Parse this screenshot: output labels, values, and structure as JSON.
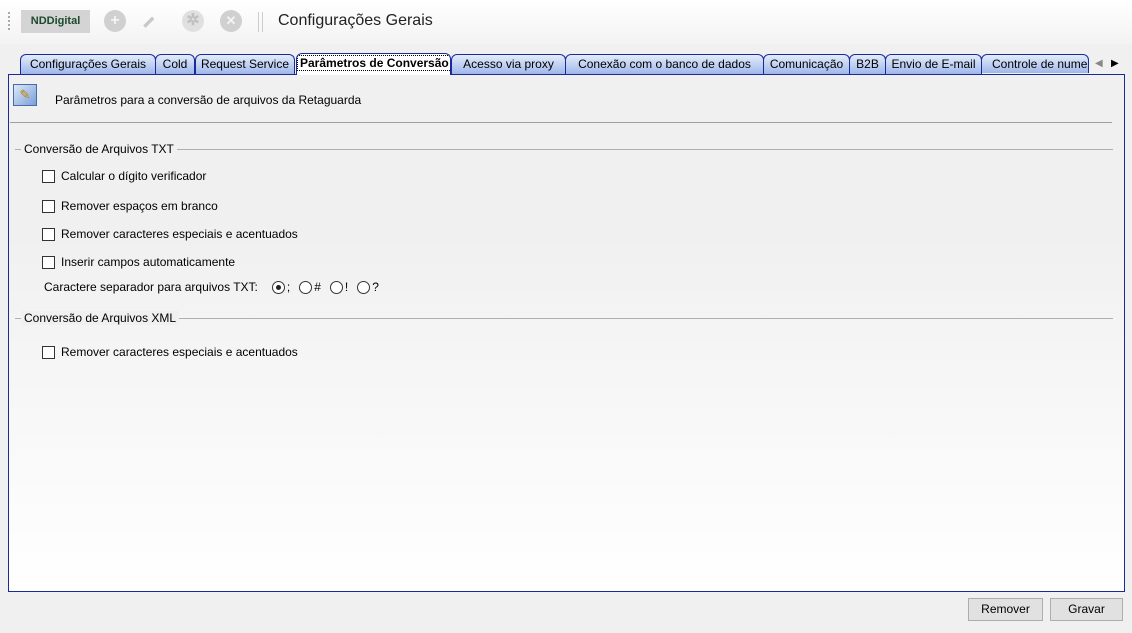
{
  "toolbar": {
    "logo": "NDDigital",
    "title": "Configurações Gerais",
    "icons": [
      "add-icon",
      "edit-icon",
      "settings-icon",
      "delete-icon"
    ]
  },
  "tabs": [
    {
      "label": "Configurações Gerais"
    },
    {
      "label": "Cold"
    },
    {
      "label": "Request Service"
    },
    {
      "label": "Parâmetros de Conversão",
      "active": true
    },
    {
      "label": "Acesso via proxy"
    },
    {
      "label": "Conexão com o banco de dados"
    },
    {
      "label": "Comunicação"
    },
    {
      "label": "B2B"
    },
    {
      "label": "Envio de E-mail"
    },
    {
      "label": "Controle de numeração"
    }
  ],
  "header": {
    "description": "Parâmetros para a conversão de arquivos da Retaguarda"
  },
  "txt": {
    "title": "Conversão de Arquivos TXT",
    "options": [
      {
        "label": "Calcular o dígito verificador",
        "checked": false
      },
      {
        "label": "Remover espaços em branco",
        "checked": false
      },
      {
        "label": "Remover caracteres especiais e acentuados",
        "checked": false
      },
      {
        "label": "Inserir campos automaticamente",
        "checked": false
      }
    ],
    "separator_label": "Caractere separador para arquivos TXT:",
    "separators": [
      {
        "label": ";",
        "selected": true
      },
      {
        "label": "#",
        "selected": false
      },
      {
        "label": "!",
        "selected": false
      },
      {
        "label": "?",
        "selected": false
      }
    ]
  },
  "xml": {
    "title": "Conversão de Arquivos XML",
    "options": [
      {
        "label": "Remover caracteres especiais e acentuados",
        "checked": false
      }
    ]
  },
  "buttons": {
    "remove": "Remover",
    "save": "Gravar"
  }
}
